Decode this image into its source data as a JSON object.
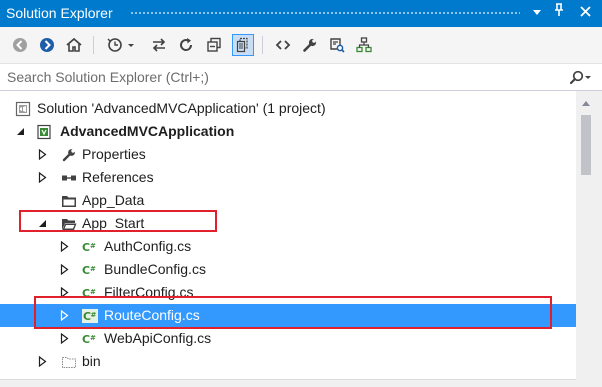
{
  "window": {
    "title": "Solution Explorer",
    "dropdown_icon": "dropdown-arrow-icon",
    "pin_icon": "pin-icon",
    "close_icon": "close-icon"
  },
  "toolbar": {
    "buttons": [
      {
        "name": "back-button",
        "icon": "back-arrow-icon"
      },
      {
        "name": "forward-button",
        "icon": "forward-arrow-icon"
      },
      {
        "name": "home-button",
        "icon": "home-icon"
      },
      {
        "name": "pending-changes-filter-button",
        "icon": "clock-icon"
      },
      {
        "name": "sync-with-active-document-button",
        "icon": "sync-icon"
      },
      {
        "name": "refresh-button",
        "icon": "refresh-icon"
      },
      {
        "name": "collapse-all-button",
        "icon": "collapse-all-icon"
      },
      {
        "name": "show-all-files-button",
        "icon": "show-all-files-icon",
        "active": true
      },
      {
        "name": "view-code-button",
        "icon": "code-brackets-icon"
      },
      {
        "name": "properties-button",
        "icon": "wrench-icon"
      },
      {
        "name": "preview-selected-items-button",
        "icon": "preview-icon"
      },
      {
        "name": "view-class-diagram-button",
        "icon": "class-diagram-icon"
      }
    ]
  },
  "search": {
    "placeholder": "Search Solution Explorer (Ctrl+;)",
    "value": "",
    "icon": "search-icon"
  },
  "tree": {
    "items": [
      {
        "label": "Solution 'AdvancedMVCApplication' (1 project)",
        "icon": "solution-icon",
        "expander": "none",
        "bold": false
      },
      {
        "label": "AdvancedMVCApplication",
        "icon": "web-project-icon",
        "expander": "expanded",
        "bold": true
      },
      {
        "label": "Properties",
        "icon": "wrench-icon",
        "expander": "collapsed",
        "bold": false
      },
      {
        "label": "References",
        "icon": "references-icon",
        "expander": "collapsed",
        "bold": false
      },
      {
        "label": "App_Data",
        "icon": "folder-icon",
        "expander": "none",
        "bold": false
      },
      {
        "label": "App_Start",
        "icon": "folder-icon",
        "expander": "expanded",
        "bold": false,
        "highlighted": true
      },
      {
        "label": "AuthConfig.cs",
        "icon": "csharp-file-icon",
        "expander": "collapsed",
        "bold": false
      },
      {
        "label": "BundleConfig.cs",
        "icon": "csharp-file-icon",
        "expander": "collapsed",
        "bold": false
      },
      {
        "label": "FilterConfig.cs",
        "icon": "csharp-file-icon",
        "expander": "collapsed",
        "bold": false
      },
      {
        "label": "RouteConfig.cs",
        "icon": "csharp-file-icon",
        "expander": "collapsed",
        "bold": false,
        "selected": true,
        "highlighted": true
      },
      {
        "label": "WebApiConfig.cs",
        "icon": "csharp-file-icon",
        "expander": "collapsed",
        "bold": false
      },
      {
        "label": "bin",
        "icon": "hidden-folder-icon",
        "expander": "collapsed",
        "bold": false
      }
    ]
  },
  "colors": {
    "accent": "#007acc",
    "selection": "#3399ff",
    "highlight_box": "#e0202a",
    "csharp_icon": "#388a34"
  }
}
